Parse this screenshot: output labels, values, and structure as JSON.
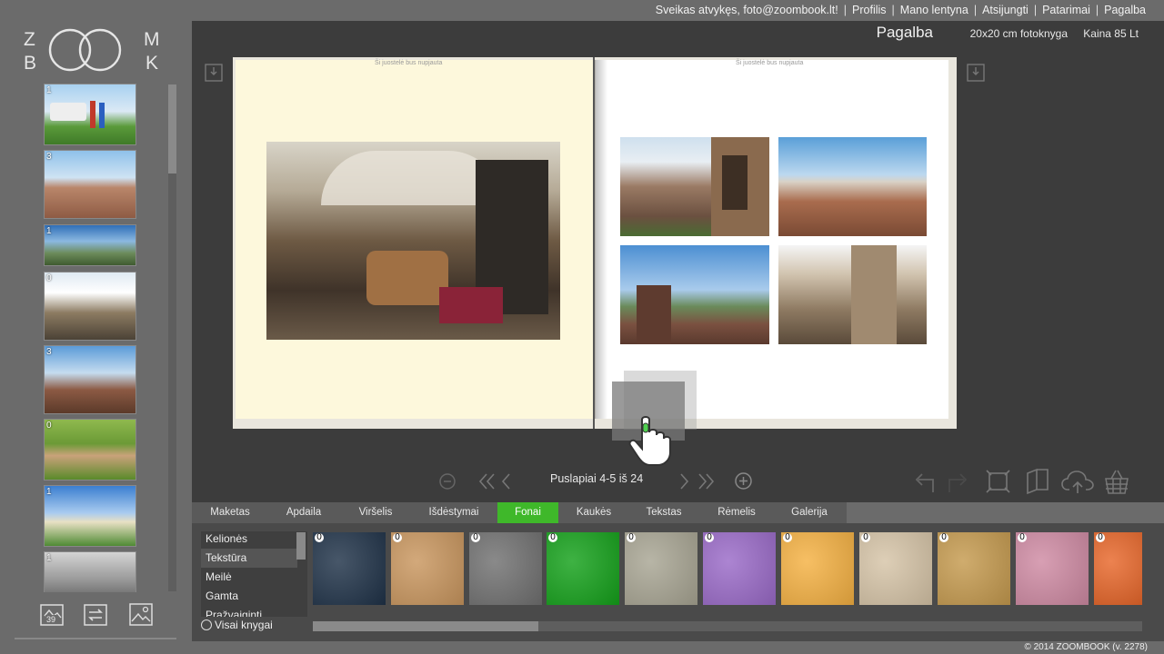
{
  "topnav": {
    "welcome": "Sveikas atvykęs, foto@zoombook.lt!",
    "links": [
      "Profilis",
      "Mano lentyna",
      "Atsijungti",
      "Patarimai",
      "Pagalba"
    ]
  },
  "brand": {
    "logo_top": "ZOOM",
    "logo_bottom": "BOOK"
  },
  "header": {
    "title": "Pagalba",
    "book_size": "20x20 cm fotoknyga",
    "price": "Kaina 85 Lt"
  },
  "thumbnails": [
    {
      "count": "1"
    },
    {
      "count": "3"
    },
    {
      "count": "1"
    },
    {
      "count": "0"
    },
    {
      "count": "3"
    },
    {
      "count": "0"
    },
    {
      "count": "1"
    },
    {
      "count": "1"
    }
  ],
  "left_tools": {
    "counter": "39"
  },
  "spread": {
    "guide_text": "Ši juostelė bus nupjauta"
  },
  "pagenav": {
    "label": "Puslapiai 4-5 iš 24"
  },
  "tabs": [
    "Maketas",
    "Apdaila",
    "Viršelis",
    "Išdėstymai",
    "Fonai",
    "Kaukės",
    "Tekstas",
    "Rėmelis",
    "Galerija"
  ],
  "active_tab": "Fonai",
  "categories": [
    "Kelionės",
    "Tekstūra",
    "Meilė",
    "Gamta",
    "Pražvaiginti"
  ],
  "selected_category": "Tekstūra",
  "all_books_label": "Visai knygai",
  "swatches": [
    {
      "count": "0",
      "color": "#1f3248"
    },
    {
      "count": "0",
      "color": "#c9965e"
    },
    {
      "count": "0",
      "color": "#707070"
    },
    {
      "count": "0",
      "color": "#14a11a"
    },
    {
      "count": "0",
      "color": "#a8a593"
    },
    {
      "count": "0",
      "color": "#9a6ac8"
    },
    {
      "count": "0",
      "color": "#f5b142"
    },
    {
      "count": "0",
      "color": "#d6c4a7"
    },
    {
      "count": "0",
      "color": "#c59a4e"
    },
    {
      "count": "0",
      "color": "#cf8aa3"
    },
    {
      "count": "0",
      "color": "#e8672a"
    }
  ],
  "copyright": "© 2014 ZOOMBOOK   (v. 2278)"
}
